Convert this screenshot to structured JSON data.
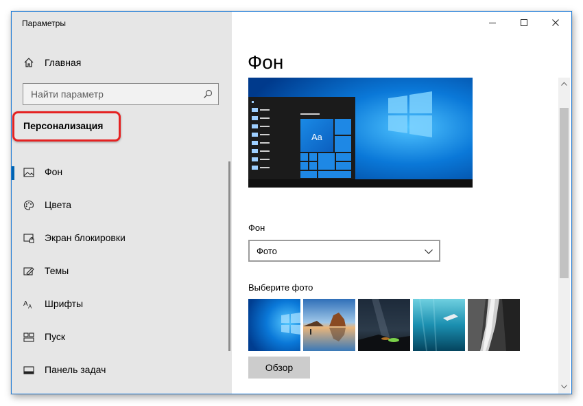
{
  "window": {
    "title": "Параметры",
    "controls": [
      "minimize-icon",
      "maximize-icon",
      "close-icon"
    ]
  },
  "sidebar": {
    "home": {
      "label": "Главная",
      "icon": "home-icon"
    },
    "search": {
      "placeholder": "Найти параметр",
      "icon": "search-icon"
    },
    "section_title": "Персонализация",
    "items": [
      {
        "label": "Фон",
        "icon": "picture-icon",
        "active": true
      },
      {
        "label": "Цвета",
        "icon": "palette-icon",
        "active": false
      },
      {
        "label": "Экран блокировки",
        "icon": "lock-screen-icon",
        "active": false
      },
      {
        "label": "Темы",
        "icon": "themes-icon",
        "active": false
      },
      {
        "label": "Шрифты",
        "icon": "fonts-icon",
        "active": false
      },
      {
        "label": "Пуск",
        "icon": "start-icon",
        "active": false
      },
      {
        "label": "Панель задач",
        "icon": "taskbar-icon",
        "active": false
      }
    ]
  },
  "main": {
    "title": "Фон",
    "preview": {
      "tile_text": "Aa"
    },
    "background_label": "Фон",
    "background_value": "Фото",
    "choose_label": "Выберите фото",
    "photos": [
      "windows-blue",
      "beach-rocks",
      "night-sky",
      "underwater-swimmer",
      "rock-waterfall"
    ],
    "browse_label": "Обзор"
  },
  "colors": {
    "accent": "#0078d7",
    "highlight": "#e52222",
    "sidebar_bg": "#e6e6e6"
  }
}
